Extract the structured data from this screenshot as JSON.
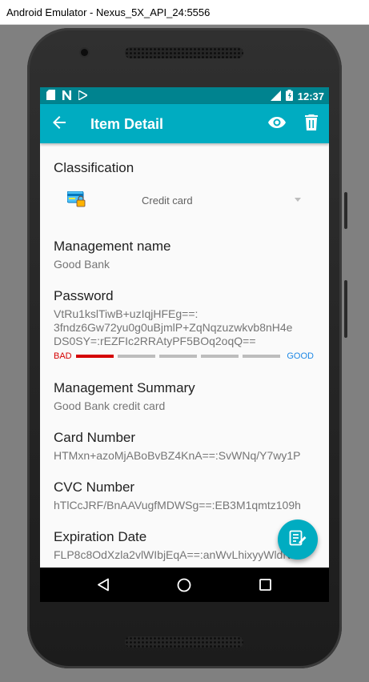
{
  "window": {
    "title": "Android Emulator - Nexus_5X_API_24:5556"
  },
  "status_bar": {
    "time": "12:37",
    "network": "LTE"
  },
  "app_bar": {
    "title": "Item Detail"
  },
  "classification": {
    "label": "Classification",
    "value": "Credit card"
  },
  "fields": [
    {
      "label": "Management name",
      "value": "Good Bank"
    },
    {
      "label": "Password",
      "value": "VtRu1kslTiwB+uzIqjHFEg==:\n3fndz6Gw72yu0g0uBjmlP+ZqNqzuzwkvb8nH4e\nDS0SY=:rEZFIc2RRAtyPF5BOq2oqQ=="
    },
    {
      "label": "Management Summary",
      "value": "Good Bank credit card"
    },
    {
      "label": "Card Number",
      "value": "HTMxn+azoMjABoBvBZ4KnA==:SvWNq/Y7wy1P"
    },
    {
      "label": "CVC Number",
      "value": "hTlCcJRF/BnAAVugfMDWSg==:EB3M1qmtz109h"
    },
    {
      "label": "Expiration Date",
      "value": "FLP8c8OdXzla2vlWIbjEqA==:anWvLhixyyWldNAII"
    }
  ],
  "password_strength": {
    "low_label": "BAD",
    "high_label": "GOOD",
    "level": 1,
    "segments": 5
  },
  "colors": {
    "primary": "#00acc1",
    "primary_dark": "#00838f",
    "bad": "#d50000",
    "good": "#1e88e5"
  },
  "icons": {
    "back": "arrow-left-icon",
    "view": "eye-icon",
    "delete": "trash-icon",
    "classification": "credit-card-lock-icon",
    "fab": "edit-note-icon",
    "nav_back": "triangle-back-icon",
    "nav_home": "circle-home-icon",
    "nav_recent": "square-recent-icon"
  }
}
